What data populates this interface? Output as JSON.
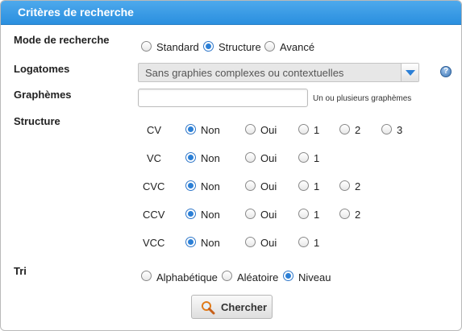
{
  "panel": {
    "title": "Critères de recherche"
  },
  "mode": {
    "label": "Mode de recherche",
    "options": [
      {
        "label": "Standard",
        "checked": false
      },
      {
        "label": "Structure",
        "checked": true
      },
      {
        "label": "Avancé",
        "checked": false
      }
    ]
  },
  "logatomes": {
    "label": "Logatomes",
    "selected": "Sans graphies complexes ou contextuelles",
    "help_icon": "help-icon",
    "help_glyph": "?"
  },
  "graphemes": {
    "label": "Graphèmes",
    "value": "",
    "placeholder": "",
    "hint": "Un ou plusieurs graphèmes"
  },
  "structure": {
    "label": "Structure",
    "rows": [
      {
        "name": "CV",
        "options": [
          "Non",
          "Oui",
          "1",
          "2",
          "3"
        ],
        "selected": "Non"
      },
      {
        "name": "VC",
        "options": [
          "Non",
          "Oui",
          "1"
        ],
        "selected": "Non"
      },
      {
        "name": "CVC",
        "options": [
          "Non",
          "Oui",
          "1",
          "2"
        ],
        "selected": "Non"
      },
      {
        "name": "CCV",
        "options": [
          "Non",
          "Oui",
          "1",
          "2"
        ],
        "selected": "Non"
      },
      {
        "name": "VCC",
        "options": [
          "Non",
          "Oui",
          "1"
        ],
        "selected": "Non"
      }
    ]
  },
  "tri": {
    "label": "Tri",
    "options": [
      {
        "label": "Alphabétique",
        "checked": false
      },
      {
        "label": "Aléatoire",
        "checked": false
      },
      {
        "label": "Niveau",
        "checked": true
      }
    ]
  },
  "search_button": {
    "label": "Chercher",
    "icon": "magnifier-icon"
  },
  "colors": {
    "header": "#3a9be6",
    "accent": "#2b7fd6",
    "text": "#222222"
  }
}
